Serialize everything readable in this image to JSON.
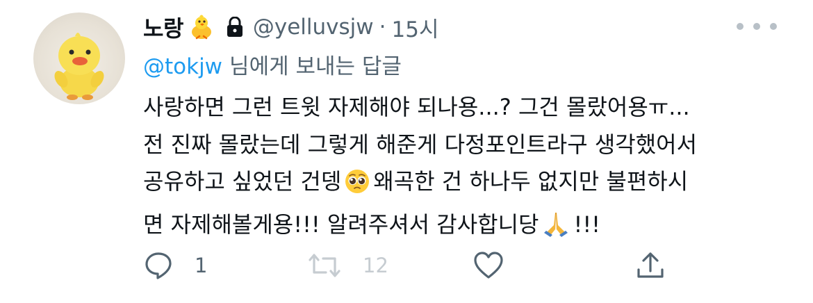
{
  "user": {
    "display_name": "노랑",
    "name_emoji": "baby-chick",
    "handle": "@yelluvsjw",
    "separator": "·",
    "time": "15시",
    "protected_icon": "lock-icon"
  },
  "reply_context": {
    "mention": "@tokjw",
    "suffix": "님에게 보내는 답글"
  },
  "tweet": {
    "line1": "사랑하면 그런 트윗 자제해야 되나용...? 그건 몰랐어용ㅠ...",
    "line2": "전 진짜 몰랐는데 그렇게 해준게 다정포인트라구 생각했어서",
    "line3_before": "공유하고 싶었던 건뎅",
    "line3_emoji": "pleading-face",
    "line3_after": "왜곡한 건 하나두 없지만 불편하시",
    "line4_before": "면 자제해볼게용!!! 알려주셔서 감사합니당",
    "line4_emoji": "folded-hands",
    "line4_after": "!!!"
  },
  "actions": {
    "reply_count": "1",
    "retweet_count": "12",
    "icons": [
      "reply-icon",
      "retweet-icon",
      "like-icon",
      "share-icon"
    ]
  },
  "colors": {
    "text": "#0f1419",
    "secondary": "#536471",
    "link": "#1d9bf0",
    "disabled": "#c6ccd1"
  }
}
